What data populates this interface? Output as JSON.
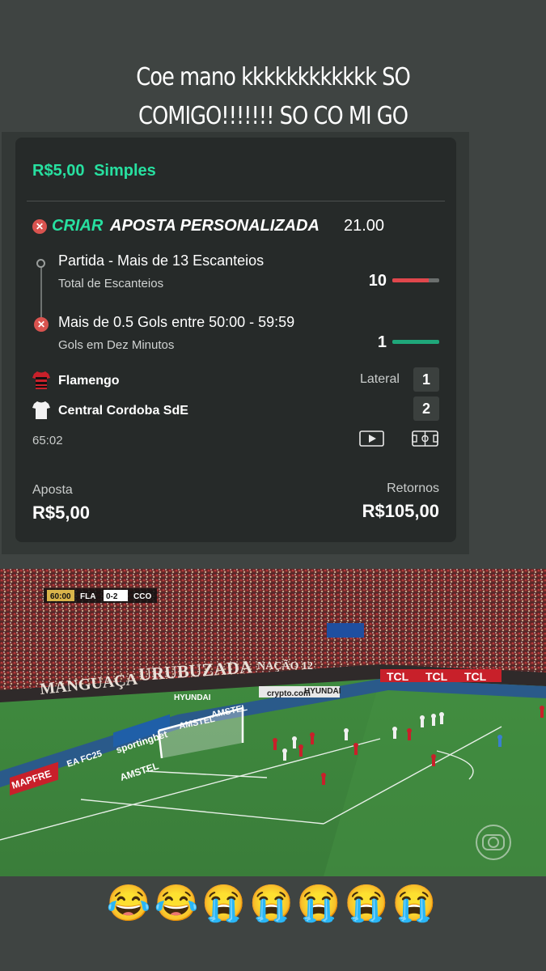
{
  "caption": {
    "line1": "Coe mano kkkkkkkkkkkk SO",
    "line2": "COMIGO!!!!!!! SO CO MI GO"
  },
  "bet": {
    "header_amount": "R$5,00",
    "header_type": "Simples",
    "title_prefix": "CRIAR",
    "title_rest": "APOSTA PERSONALIZADA",
    "odds": "21.00",
    "legs": [
      {
        "title": "Partida - Mais de 13 Escanteios",
        "subtitle": "Total de Escanteios",
        "current": "10",
        "progress": 0.78,
        "bar_color": "#e0474c",
        "status_icon": "circle-outline-icon"
      },
      {
        "title": "Mais de 0.5 Gols entre 50:00 - 59:59",
        "subtitle": "Gols em Dez Minutos",
        "current": "1",
        "progress": 1.0,
        "bar_color": "#1fa77a",
        "status_icon": "x-circle-icon"
      }
    ],
    "teams": [
      {
        "name": "Flamengo",
        "score": "1",
        "icon": "flamengo-jersey-icon"
      },
      {
        "name": "Central Cordoba SdE",
        "score": "2",
        "icon": "white-jersey-icon"
      }
    ],
    "event_label": "Lateral",
    "clock": "65:02",
    "stake_label": "Aposta",
    "stake_value": "R$5,00",
    "returns_label": "Retornos",
    "returns_value": "R$105,00"
  },
  "broadcast": {
    "clock": "60:00",
    "home": "FLA",
    "score": "0-2",
    "away": "CCO",
    "ads": [
      "URUBUZADA",
      "MANGUAÇA",
      "TCL",
      "TCL",
      "TCL",
      "HYUNDAI",
      "crypto.com",
      "HYUNDAI",
      "AMSTEL",
      "AMSTEL",
      "sportingbet",
      "EA FC25",
      "MAPFRE",
      "AMSTEL",
      "NAÇÃO 12"
    ]
  },
  "emojis": "😂😂😭😭😭😭😭"
}
